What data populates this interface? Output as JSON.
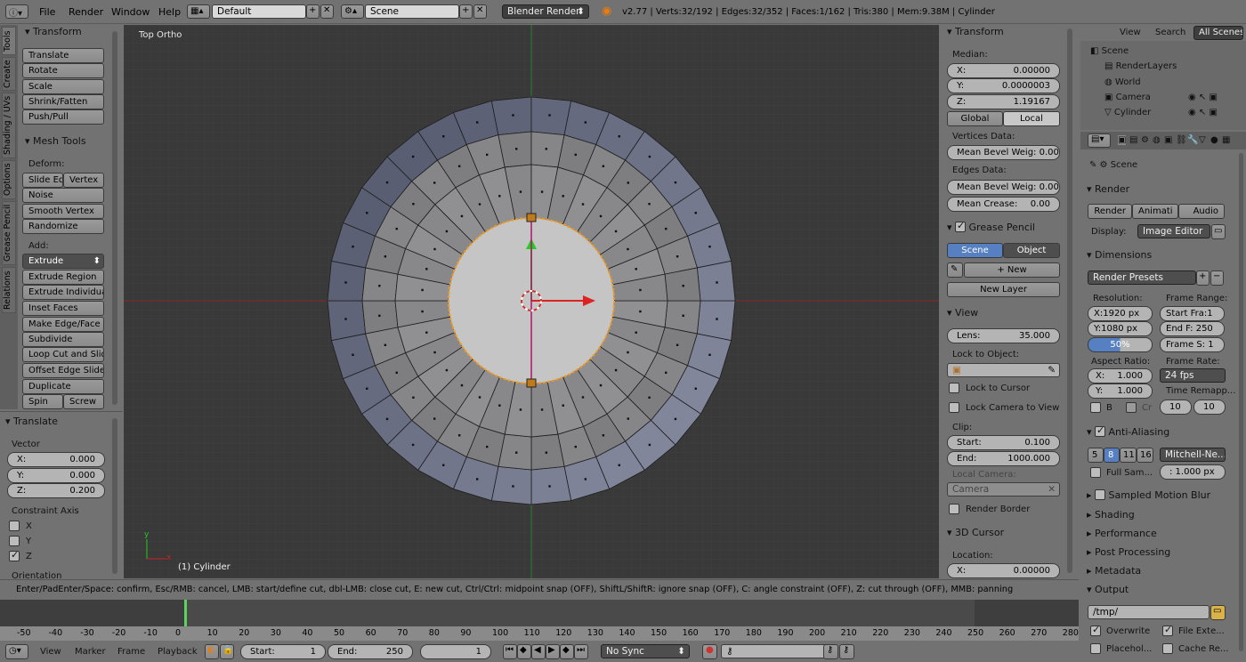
{
  "topbar": {
    "menus": [
      "File",
      "Render",
      "Window",
      "Help"
    ],
    "layout": "Default",
    "scene": "Scene",
    "engine": "Blender Render",
    "stats": "v2.77 | Verts:32/192 | Edges:32/352 | Faces:1/162 | Tris:380 | Mem:9.38M | Cylinder"
  },
  "vtabs": [
    "Tools",
    "Create",
    "Shading / UVs",
    "Options",
    "Grease Pencil",
    "Relations"
  ],
  "tools": {
    "transform_title": "Transform",
    "transform": [
      "Translate",
      "Rotate",
      "Scale",
      "Shrink/Fatten",
      "Push/Pull"
    ],
    "mesh_title": "Mesh Tools",
    "deform_label": "Deform:",
    "deform": [
      "Slide Ed",
      "Vertex",
      "Noise",
      "Smooth Vertex",
      "Randomize"
    ],
    "add_label": "Add:",
    "extrude": "Extrude",
    "add": [
      "Extrude Region",
      "Extrude Individual",
      "Inset Faces",
      "Make Edge/Face",
      "Subdivide",
      "Loop Cut and Slide",
      "Offset Edge Slide",
      "Duplicate"
    ],
    "spin": "Spin",
    "screw": "Screw"
  },
  "operator": {
    "title": "Translate",
    "vector": "Vector",
    "x": "X:",
    "xv": "0.000",
    "y": "Y:",
    "yv": "0.000",
    "z": "Z:",
    "zv": "0.200",
    "constraint": "Constraint Axis",
    "cx": "X",
    "cy": "Y",
    "cz": "Z",
    "orientation": "Orientation"
  },
  "viewport": {
    "label": "Top Ortho",
    "object": "(1) Cylinder",
    "axis_x": "x",
    "axis_y": "y"
  },
  "npanel": {
    "transform": "Transform",
    "median": "Median:",
    "x": "X:",
    "xv": "0.00000",
    "y": "Y:",
    "yv": "0.0000003",
    "z": "Z:",
    "zv": "1.19167",
    "global": "Global",
    "local": "Local",
    "vdata": "Vertices Data:",
    "vbevel": "Mean Bevel Weig: 0.00",
    "edata": "Edges Data:",
    "ebevel": "Mean Bevel Weig: 0.00",
    "crease": "Mean Crease:",
    "creasev": "0.00",
    "gp": "Grease Pencil",
    "scene": "Scene",
    "object": "Object",
    "new": "New",
    "newlayer": "New Layer",
    "view": "View",
    "lens": "Lens:",
    "lensv": "35.000",
    "lock": "Lock to Object:",
    "lockcursor": "Lock to Cursor",
    "lockcam": "Lock Camera to View",
    "clip": "Clip:",
    "start": "Start:",
    "startv": "0.100",
    "end": "End:",
    "endv": "1000.000",
    "localcam": "Local Camera:",
    "camera": "Camera",
    "border": "Render Border",
    "cursor": "3D Cursor",
    "location": "Location:",
    "cx": "X:",
    "cxv": "0.00000"
  },
  "outliner": {
    "view": "View",
    "search": "Search",
    "all": "All Scenes",
    "items": [
      "Scene",
      "RenderLayers",
      "World",
      "Camera",
      "Cylinder"
    ]
  },
  "props": {
    "scene": "Scene",
    "render": "Render",
    "render_btn": "Render",
    "anim_btn": "Animati",
    "audio_btn": "Audio",
    "display": "Display:",
    "display_val": "Image Editor",
    "dimensions": "Dimensions",
    "presets": "Render Presets",
    "resolution": "Resolution:",
    "frame_range": "Frame Range:",
    "resx": "X:1920 px",
    "resy": "Y:1080 px",
    "pct": "50%",
    "start": "Start Fra:1",
    "end": "End F: 250",
    "step": "Frame S: 1",
    "aspect": "Aspect Ratio:",
    "framerate": "Frame Rate:",
    "ax": "X:",
    "axv": "1.000",
    "ay": "Y:",
    "ayv": "1.000",
    "fps": "24 fps",
    "remap": "Time Remapp...",
    "b": "B",
    "cr": "Cr",
    "r1": "10",
    "r2": "10",
    "aa": "Anti-Aliasing",
    "aa5": "5",
    "aa8": "8",
    "aa11": "11",
    "aa16": "16",
    "filter": "Mitchell-Ne...",
    "fullsample": "Full Sam...",
    "fsize": ": 1.000 px",
    "motion": "Sampled Motion Blur",
    "shading": "Shading",
    "performance": "Performance",
    "post": "Post Processing",
    "metadata": "Metadata",
    "output": "Output",
    "path": "/tmp/",
    "overwrite": "Overwrite",
    "fileext": "File Exte...",
    "placeholder": "Placehol...",
    "cache": "Cache Re..."
  },
  "status": "Enter/PadEnter/Space: confirm, Esc/RMB: cancel, LMB: start/define cut, dbl-LMB: close cut, E: new cut, Ctrl/Ctrl: midpoint snap (OFF), ShiftL/ShiftR: ignore snap (OFF), C: angle constraint (OFF), Z: cut through (OFF), MMB: panning",
  "timeline": {
    "ticks": [
      "-50",
      "-40",
      "-30",
      "-20",
      "-10",
      "0",
      "10",
      "20",
      "30",
      "40",
      "50",
      "60",
      "70",
      "80",
      "90",
      "100",
      "110",
      "120",
      "130",
      "140",
      "150",
      "160",
      "170",
      "180",
      "190",
      "200",
      "210",
      "220",
      "230",
      "240",
      "250",
      "260",
      "270",
      "280"
    ],
    "menus": [
      "View",
      "Marker",
      "Frame",
      "Playback"
    ],
    "start": "Start:",
    "startv": "1",
    "end": "End:",
    "endv": "250",
    "current": "1",
    "sync": "No Sync"
  },
  "colors": {
    "viewport": "#393939",
    "accent": "#5680c2",
    "selected": "#f39a1d"
  }
}
